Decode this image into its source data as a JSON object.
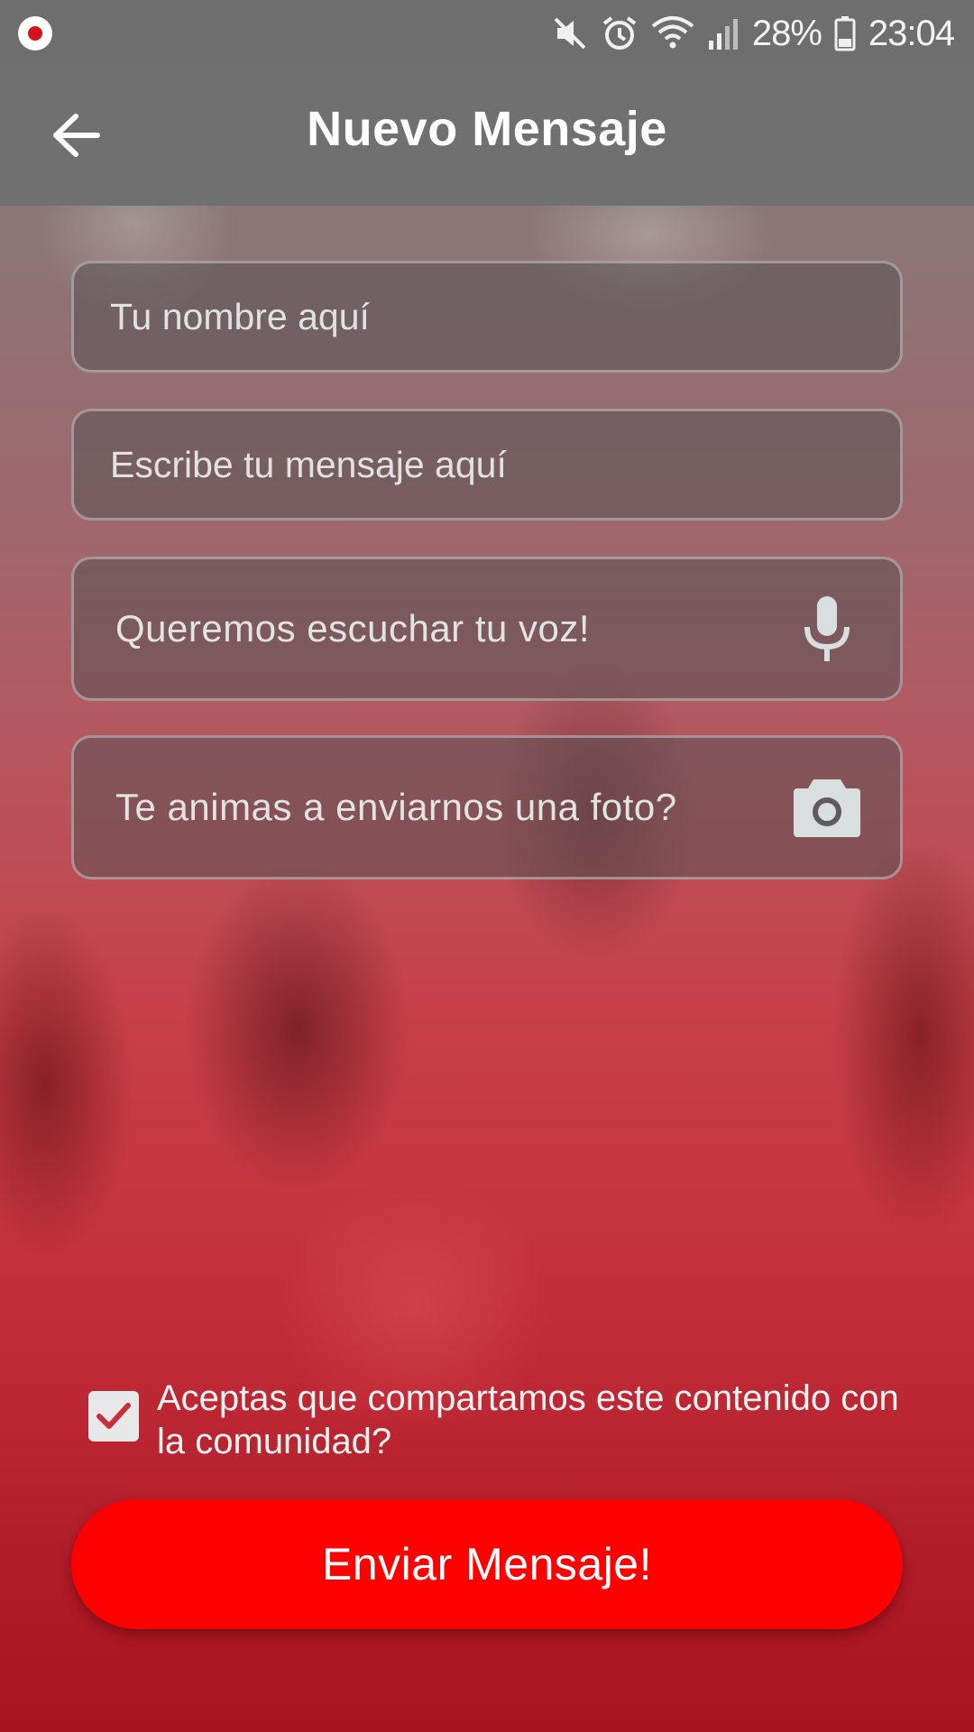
{
  "status_bar": {
    "battery": "28%",
    "time": "23:04",
    "icons": [
      "app-logo-icon",
      "mute-icon",
      "alarm-icon",
      "wifi-icon",
      "signal-icon",
      "battery-icon"
    ]
  },
  "header": {
    "title": "Nuevo Mensaje",
    "back_icon": "arrow-left-icon"
  },
  "form": {
    "name_placeholder": "Tu nombre aquí",
    "message_placeholder": "Escribe tu mensaje aquí",
    "voice_label": "Queremos escuchar tu voz!",
    "voice_icon": "microphone-icon",
    "photo_label": "Te animas a enviarnos una foto?",
    "photo_icon": "camera-icon"
  },
  "consent": {
    "checked": true,
    "text": "Aceptas que compartamos este contenido con la comunidad?"
  },
  "send_button": {
    "label": "Enviar Mensaje!"
  },
  "colors": {
    "accent": "#fe0000",
    "header": "#707070"
  }
}
